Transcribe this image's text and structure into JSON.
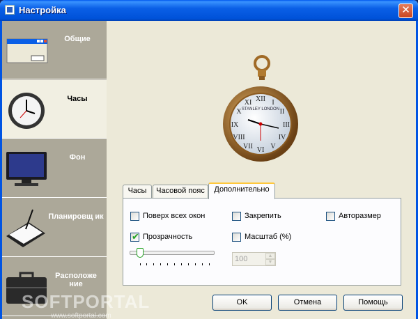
{
  "window": {
    "title": "Настройка",
    "close_glyph": "✕"
  },
  "sidebar": {
    "items": [
      {
        "label": "Общие",
        "icon": "window-icon",
        "active": false
      },
      {
        "label": "Часы",
        "icon": "clock-icon",
        "active": true
      },
      {
        "label": "Фон",
        "icon": "monitor-icon",
        "active": false
      },
      {
        "label": "Планировщ ик",
        "icon": "planner-icon",
        "active": false
      },
      {
        "label": "Расположе ние",
        "icon": "briefcase-icon",
        "active": false
      }
    ]
  },
  "tabs": [
    {
      "label": "Часы",
      "active": false
    },
    {
      "label": "Часовой пояс",
      "active": false
    },
    {
      "label": "Дополнительно",
      "active": true
    }
  ],
  "options": {
    "on_top": {
      "label": "Поверх всех окон",
      "checked": false
    },
    "pin": {
      "label": "Закрепить",
      "checked": false
    },
    "autosize": {
      "label": "Авторазмер",
      "checked": false
    },
    "transparency": {
      "label": "Прозрачность",
      "checked": true
    },
    "scale": {
      "label": "Масштаб (%)",
      "checked": false
    }
  },
  "transparency_slider": {
    "value_fraction": 0.1
  },
  "scale_spin": {
    "value": "100",
    "up": "▲",
    "down": "▼"
  },
  "buttons": {
    "ok": "OK",
    "cancel": "Отмена",
    "help": "Помощь"
  },
  "clock_face": {
    "text": "STANLEY LONDON"
  },
  "watermark": {
    "text": "SOFTPORTAL",
    "sub": "www.softportal.com"
  },
  "colors": {
    "titlebar": "#0a5fe6",
    "sidebar": "#aca899",
    "active_item": "#f1efe2",
    "accent_tab": "#ffc83c",
    "check": "#21a121"
  }
}
